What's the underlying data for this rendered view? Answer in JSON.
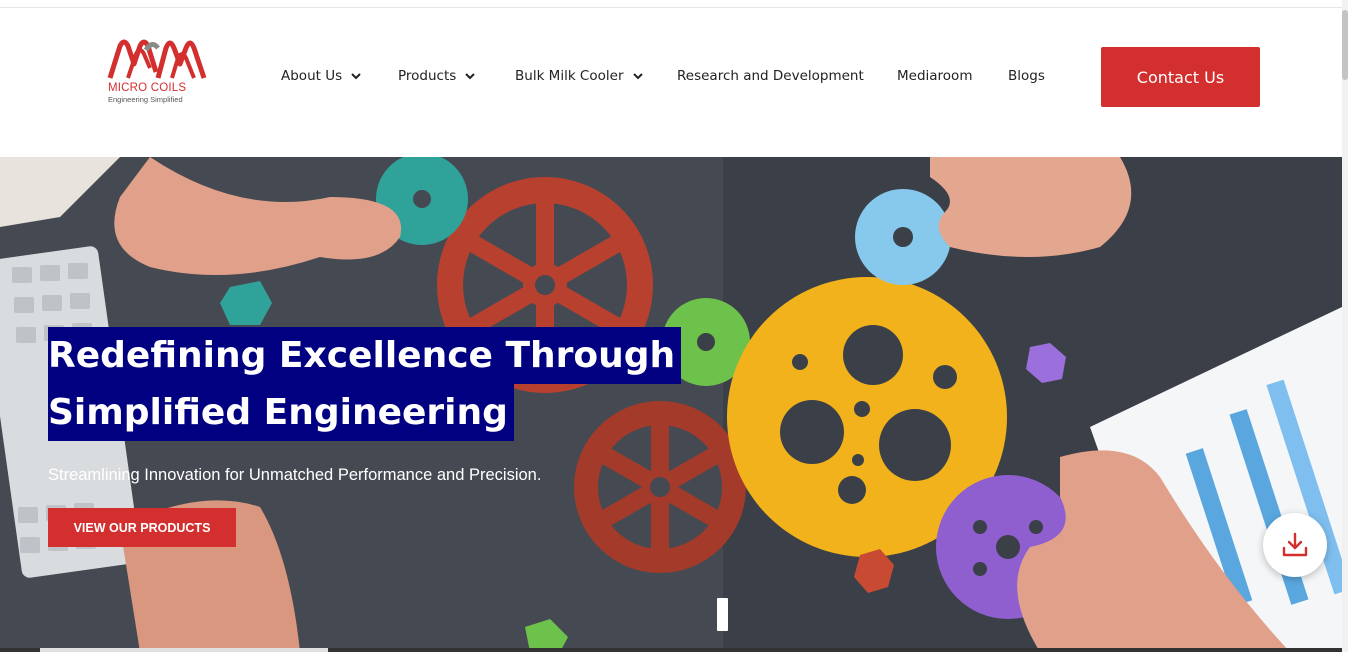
{
  "brand": {
    "name": "MICRO COILS",
    "tagline": "Engineering Simplified",
    "color": "#d32f2f"
  },
  "nav": {
    "items": [
      {
        "label": "About Us",
        "has_dropdown": true
      },
      {
        "label": "Products",
        "has_dropdown": true
      },
      {
        "label": "Bulk Milk Cooler",
        "has_dropdown": true
      },
      {
        "label": "Research and Development",
        "has_dropdown": false
      },
      {
        "label": "Mediaroom",
        "has_dropdown": false
      },
      {
        "label": "Blogs",
        "has_dropdown": false
      }
    ],
    "contact_label": "Contact Us"
  },
  "hero": {
    "headline_line1": "Redefining Excellence Through",
    "headline_line2": "Simplified Engineering",
    "subheadline": "Streamlining Innovation for Unmatched Performance and Precision.",
    "cta_label": "VIEW OUR PRODUCTS",
    "headline_highlight_color": "#000080"
  },
  "icons": {
    "download": "download-icon",
    "chevron": "chevron-down-icon"
  },
  "colors": {
    "accent": "#d32f2f",
    "nav_text": "#222222"
  }
}
